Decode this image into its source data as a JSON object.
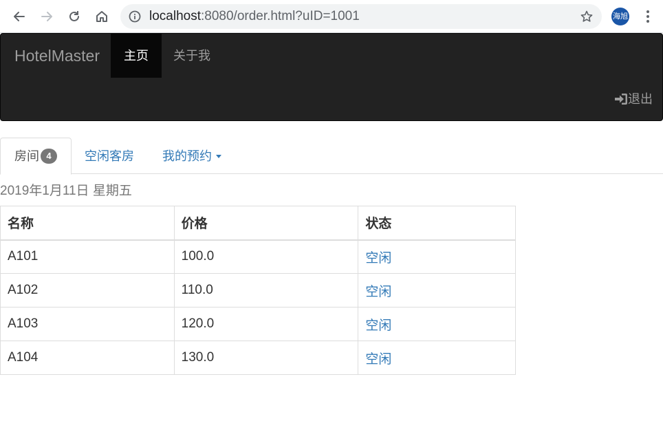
{
  "browser": {
    "url_host": "localhost",
    "url_rest": ":8080/order.html?uID=1001",
    "profile_initials": "海旭"
  },
  "navbar": {
    "brand": "HotelMaster",
    "items": [
      {
        "label": "主页",
        "active": true
      },
      {
        "label": "关于我",
        "active": false
      }
    ],
    "logout_label": "退出"
  },
  "tabs": {
    "rooms_label": "房间",
    "rooms_count": "4",
    "vacant_label": "空闲客房",
    "my_booking_label": "我的预约"
  },
  "date_text": "2019年1月11日 星期五",
  "table": {
    "headers": [
      "名称",
      "价格",
      "状态"
    ],
    "rows": [
      {
        "name": "A101",
        "price": "100.0",
        "status": "空闲"
      },
      {
        "name": "A102",
        "price": "110.0",
        "status": "空闲"
      },
      {
        "name": "A103",
        "price": "120.0",
        "status": "空闲"
      },
      {
        "name": "A104",
        "price": "130.0",
        "status": "空闲"
      }
    ]
  },
  "colors": {
    "navbar_bg": "#222222",
    "link": "#337ab7",
    "badge": "#777777",
    "avatar": "#1a56a7"
  }
}
